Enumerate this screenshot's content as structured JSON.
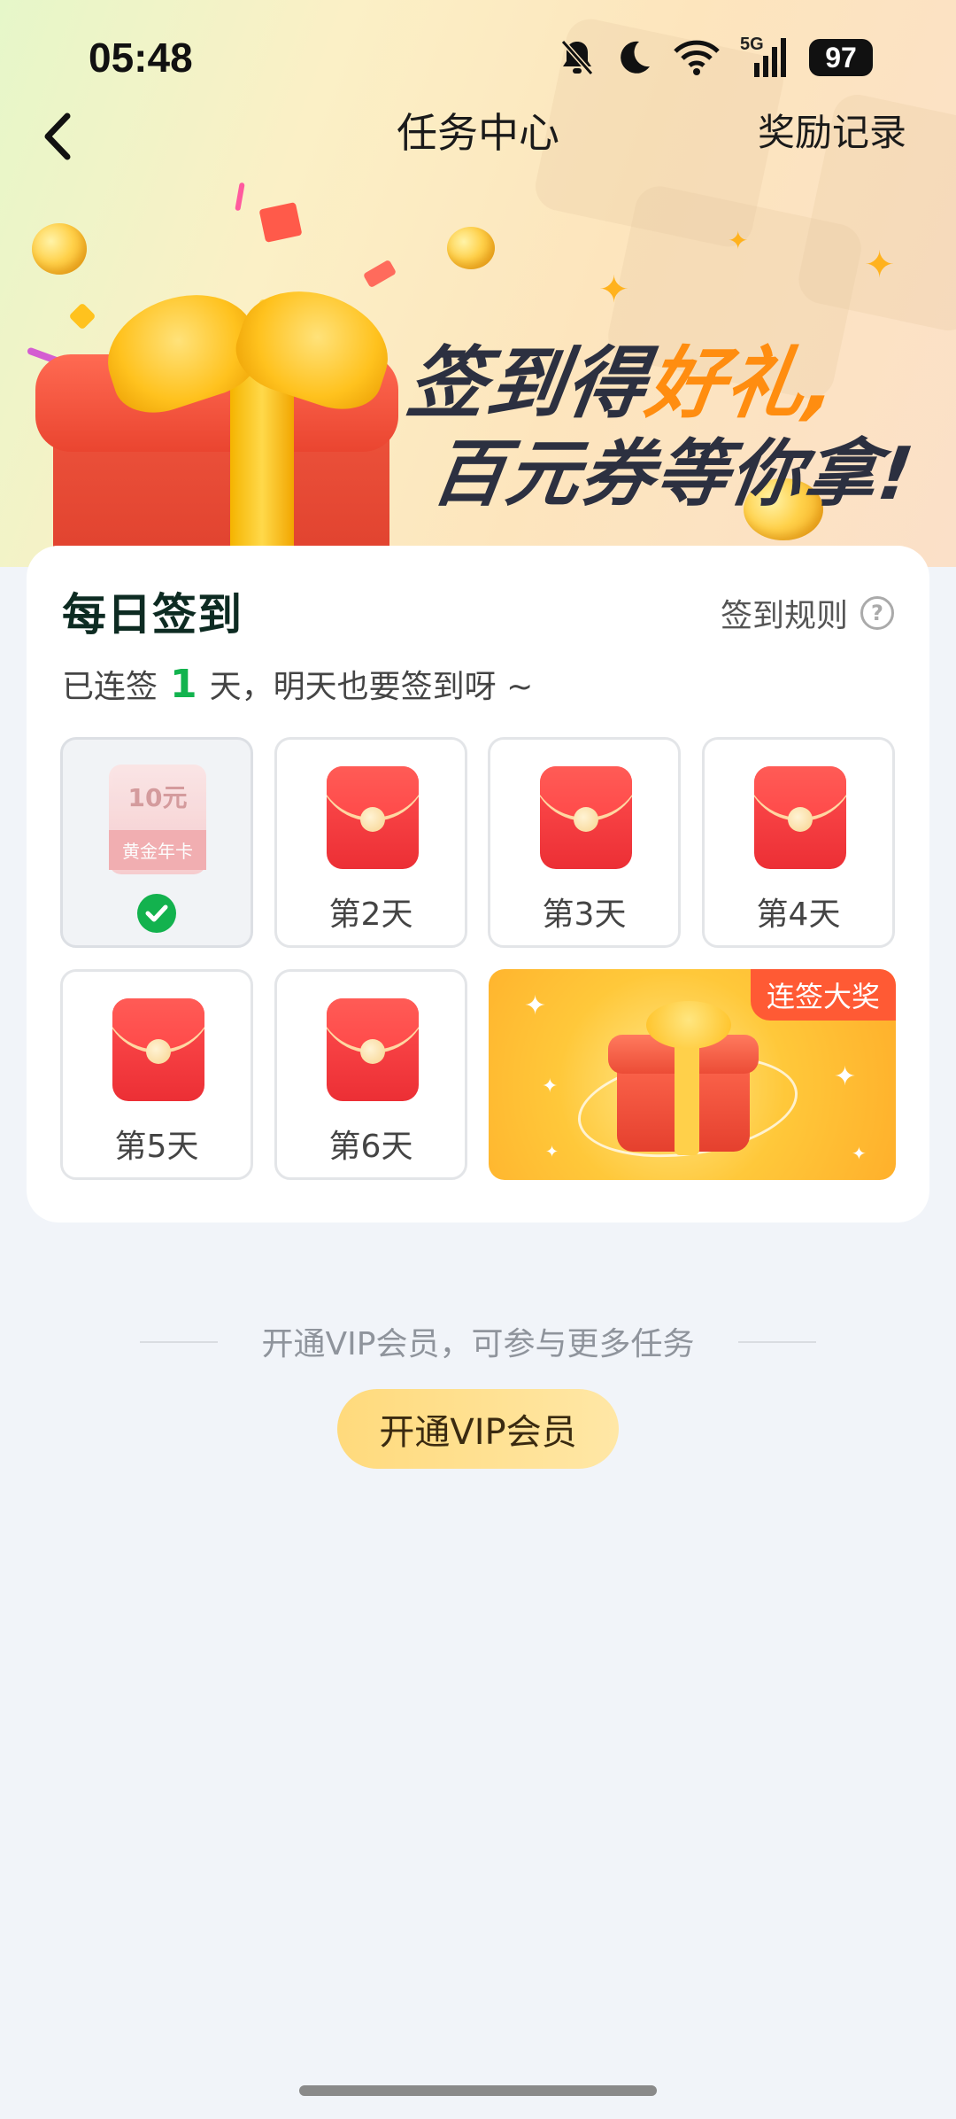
{
  "status_bar": {
    "time": "05:48",
    "network": "5G",
    "battery": "97",
    "icons": [
      "bell-off-icon",
      "moon-icon",
      "wifi-icon",
      "signal-icon",
      "battery-icon"
    ]
  },
  "nav": {
    "title": "任务中心",
    "right_link": "奖励记录",
    "back_icon": "chevron-left-icon"
  },
  "banner": {
    "line1_a": "签到得",
    "line1_b": "好礼,",
    "line2": "百元券等你拿!",
    "highlight_color": "#ff8d10"
  },
  "checkin": {
    "title": "每日签到",
    "rules_label": "签到规则",
    "streak_prefix": "已连签",
    "streak_days": "1",
    "streak_suffix": "天，明天也要签到呀 ~",
    "day1": {
      "voucher_amount": "10元",
      "voucher_name": "黄金年卡",
      "status": "checked"
    },
    "days": [
      {
        "label": "第2天"
      },
      {
        "label": "第3天"
      },
      {
        "label": "第4天"
      },
      {
        "label": "第5天"
      },
      {
        "label": "第6天"
      }
    ],
    "grand_prize_tag": "连签大奖",
    "accent_color": "#13b24e"
  },
  "vip": {
    "hint": "开通VIP会员，可参与更多任务",
    "button_label": "开通VIP会员"
  }
}
